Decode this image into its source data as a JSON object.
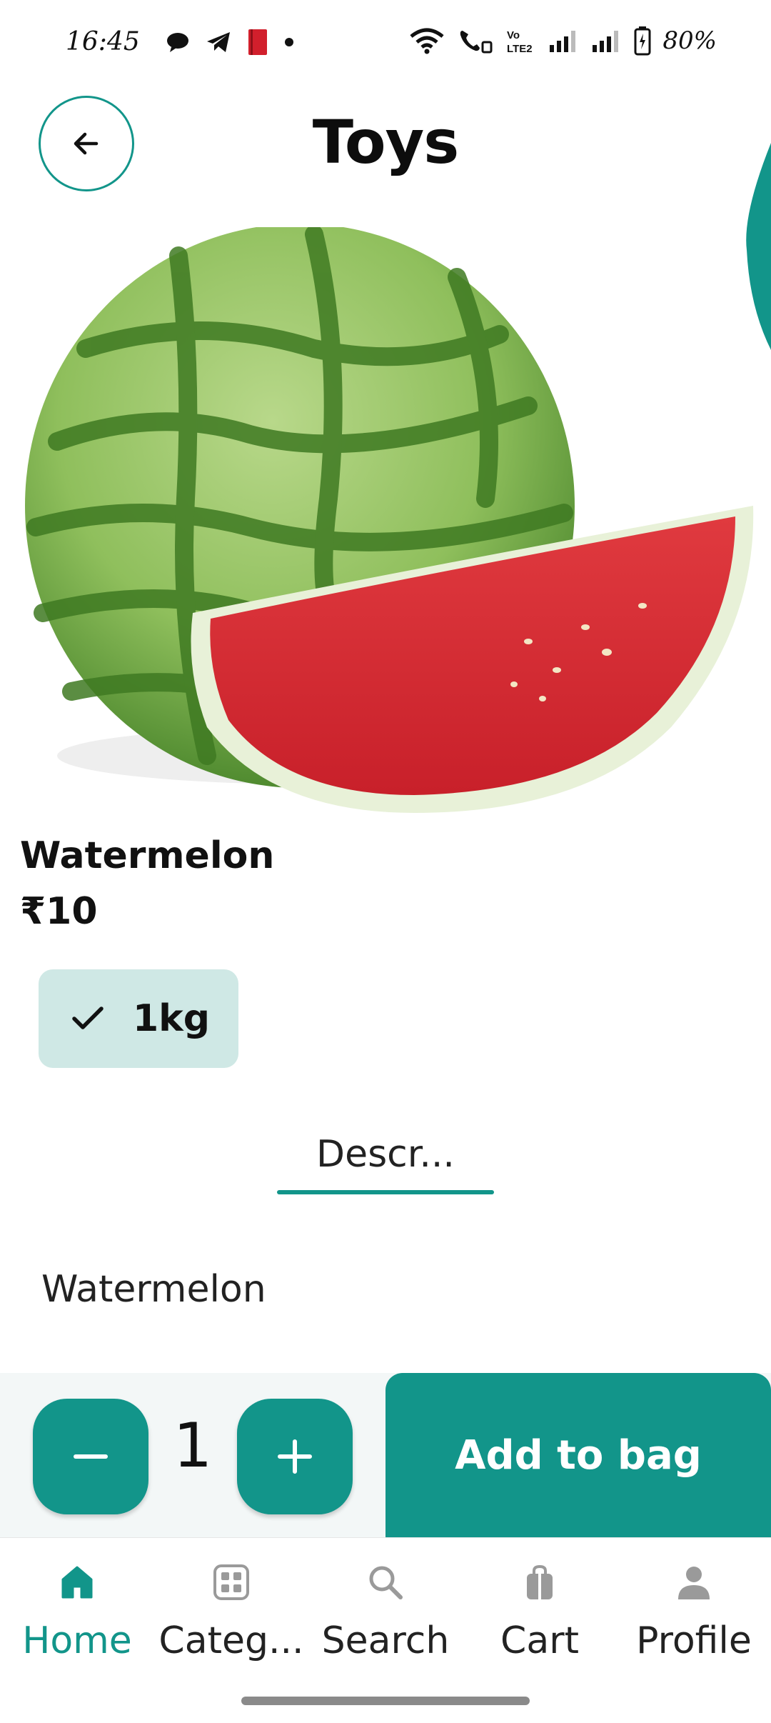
{
  "status_bar": {
    "time": "16:45",
    "battery": "80%"
  },
  "header": {
    "title": "Toys"
  },
  "product": {
    "name": "Watermelon",
    "price": "₹10",
    "variant": "1kg"
  },
  "tabs": [
    {
      "label": "Descr..."
    }
  ],
  "description": "Watermelon",
  "cart_bar": {
    "quantity": "1",
    "add_label": "Add to bag"
  },
  "bottom_nav": [
    {
      "label": "Home",
      "icon": "home-icon",
      "active": true
    },
    {
      "label": "Categ...",
      "icon": "grid-icon",
      "active": false
    },
    {
      "label": "Search",
      "icon": "search-icon",
      "active": false
    },
    {
      "label": "Cart",
      "icon": "bag-icon",
      "active": false
    },
    {
      "label": "Profile",
      "icon": "user-icon",
      "active": false
    }
  ],
  "colors": {
    "accent": "#12958a",
    "chip_bg": "#cfe8e5",
    "inactive_icon": "#9a9a9a"
  }
}
